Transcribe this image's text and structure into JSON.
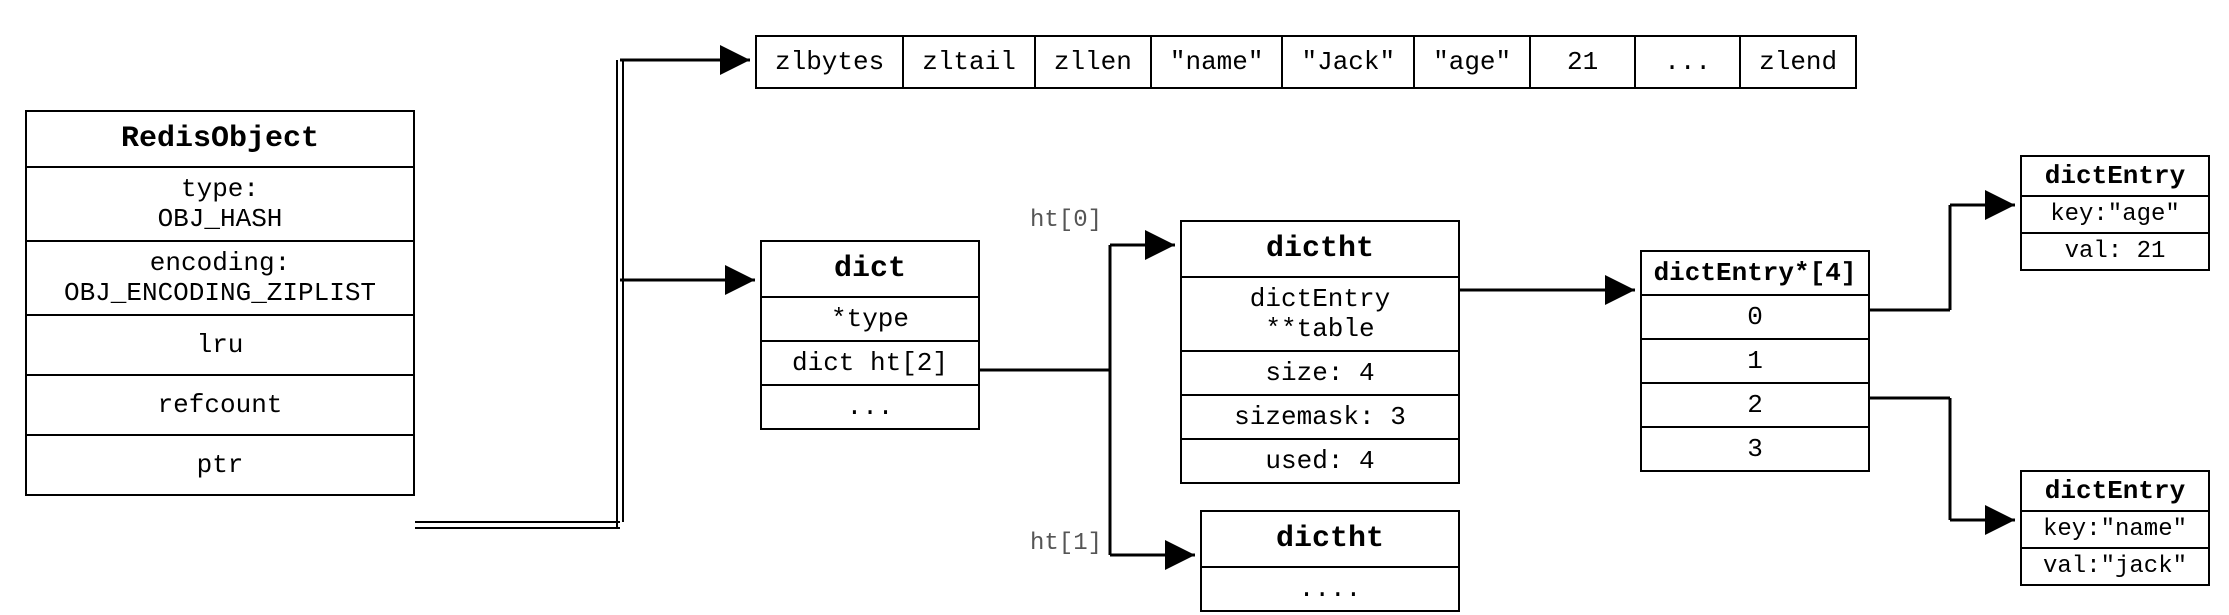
{
  "redisObject": {
    "title": "RedisObject",
    "type_line1": "type:",
    "type_line2": "OBJ_HASH",
    "enc_line1": "encoding:",
    "enc_line2": "OBJ_ENCODING_ZIPLIST",
    "lru": "lru",
    "refcount": "refcount",
    "ptr": "ptr"
  },
  "ziplist": {
    "c0": "zlbytes",
    "c1": "zltail",
    "c2": "zllen",
    "c3": "\"name\"",
    "c4": "\"Jack\"",
    "c5": "\"age\"",
    "c6": "21",
    "c7": "...",
    "c8": "zlend"
  },
  "dict": {
    "title": "dict",
    "r0": "*type",
    "r1": "dict ht[2]",
    "r2": "..."
  },
  "htlabels": {
    "ht0": "ht[0]",
    "ht1": "ht[1]"
  },
  "dictht0": {
    "title": "dictht",
    "r0": "dictEntry **table",
    "r1": "size: 4",
    "r2": "sizemask: 3",
    "r3": "used: 4"
  },
  "dictht1": {
    "title": "dictht",
    "r0": "...."
  },
  "entryArr": {
    "title": "dictEntry*[4]",
    "r0": "0",
    "r1": "1",
    "r2": "2",
    "r3": "3"
  },
  "entryA": {
    "title": "dictEntry",
    "key": "key:\"age\"",
    "val": "val: 21"
  },
  "entryB": {
    "title": "dictEntry",
    "key": "key:\"name\"",
    "val": "val:\"jack\""
  }
}
